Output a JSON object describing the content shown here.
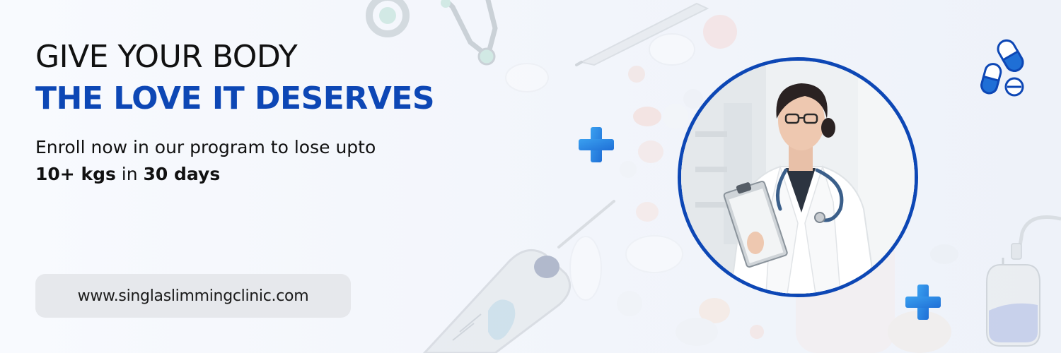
{
  "headline": {
    "line1": "GIVE YOUR BODY",
    "line2": "THE LOVE IT DESERVES"
  },
  "offer": {
    "line1": "Enroll now in our program to lose upto",
    "amount": "10+ kgs",
    "connector": " in ",
    "duration": "30 days"
  },
  "website": {
    "url": "www.singlaslimmingclinic.com"
  },
  "colors": {
    "brand_blue": "#0d47b5",
    "accent_blue": "#2f8fe8",
    "text_dark": "#111111",
    "pill_background": "#e6e8ec"
  },
  "icons": [
    "stethoscope-icon",
    "thermometer-icon",
    "syringe-icon",
    "capsule-pills-icon",
    "plus-cross-icon",
    "iv-bag-icon"
  ]
}
